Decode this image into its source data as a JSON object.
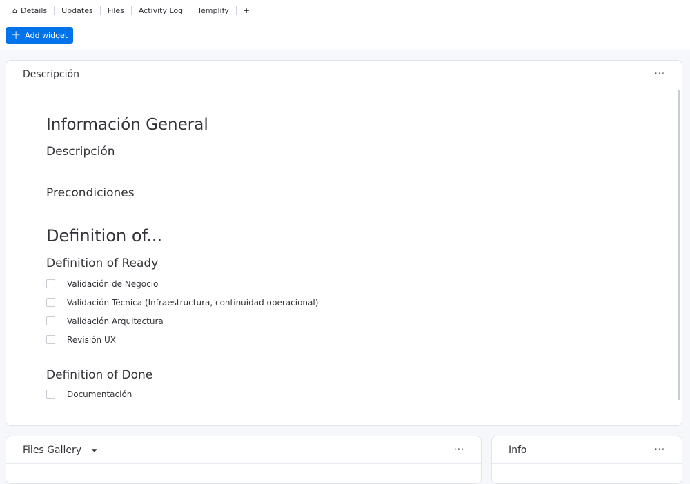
{
  "tabs": [
    "Details",
    "Updates",
    "Files",
    "Activity Log",
    "Templify"
  ],
  "add_tab": "+",
  "add_widget": "Add widget",
  "desc_card": {
    "title": "Descripción",
    "menu": "···",
    "h_general": "Información General",
    "h_desc": "Descripción",
    "h_pre": "Precondiciones",
    "h_def": "Definition of...",
    "h_ready": "Definition of Ready",
    "ready": [
      "Validación de Negocio",
      "Validación Técnica (Infraestructura, continuidad operacional)",
      "Validación Arquitectura",
      "Revisión UX"
    ],
    "h_done": "Definition of Done",
    "done": [
      "Documentación"
    ]
  },
  "files_card": {
    "title": "Files Gallery",
    "menu": "···"
  },
  "info_card": {
    "title": "Info",
    "menu": "···"
  }
}
